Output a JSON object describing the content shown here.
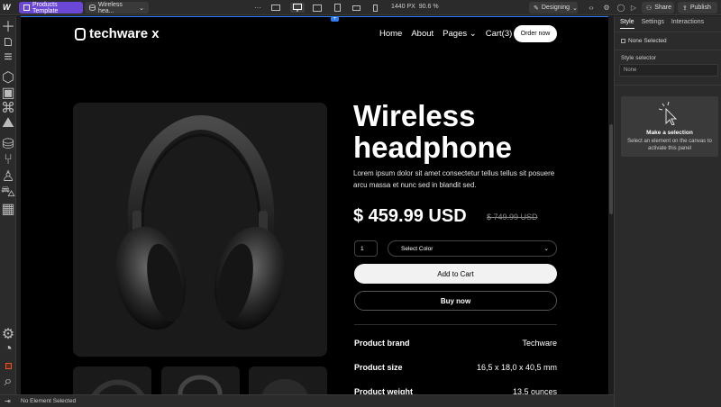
{
  "topbar": {
    "component_chip": "Products Template",
    "page_chip": "Wireless hea...",
    "more": "···",
    "width": "1440 PX",
    "zoom": "90.6 %",
    "mode": "Designing",
    "share": "Share",
    "publish": "Publish"
  },
  "site": {
    "logo_text": "techware x",
    "nav": [
      "Home",
      "About",
      "Pages",
      "Cart(3)"
    ],
    "order_button": "Order now"
  },
  "product": {
    "title_line1": "Wireless",
    "title_line2": "headphone",
    "description": "Lorem ipsum dolor sit amet consectetur tellus tellus sit posuere arcu massa et nunc sed in blandit sed.",
    "price": "$ 459.99 USD",
    "old_price": "$ 749.99 USD",
    "quantity": "1",
    "select_placeholder": "Select Color",
    "add_to_cart": "Add to Cart",
    "buy_now": "Buy now",
    "specs": [
      {
        "key": "Product brand",
        "value": "Techware"
      },
      {
        "key": "Product size",
        "value": "16,5 x 18,0 x 40,5 mm"
      },
      {
        "key": "Product weight",
        "value": "13.5 ounces"
      }
    ]
  },
  "right_panel": {
    "tabs": [
      "Style",
      "Settings",
      "Interactions"
    ],
    "none_selected": "None Selected",
    "style_selector": "Style selector",
    "style_value": "None",
    "selection_title": "Make a selection",
    "selection_text": "Select an element on the canvas to activate this panel"
  },
  "status": {
    "text": "No Element Selected"
  },
  "colors": {
    "accent_purple": "#6b47d6",
    "selection_blue": "#2f7bf5",
    "canvas_bg": "#000000",
    "editor_bg": "#2b2b2b"
  }
}
